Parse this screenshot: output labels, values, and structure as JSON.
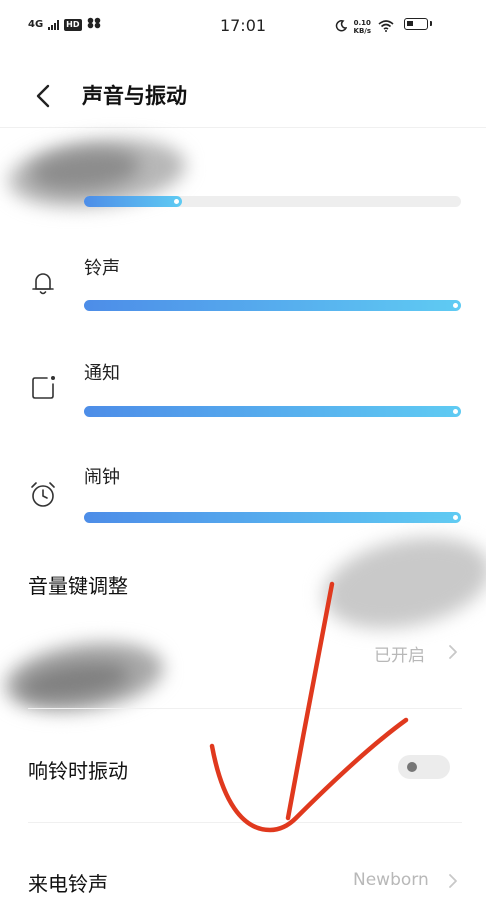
{
  "status_bar": {
    "network": "4G",
    "hd": "HD",
    "time": "17:01",
    "speed_value": "0.10",
    "speed_unit": "KB/s"
  },
  "header": {
    "title": "声音与振动"
  },
  "volume": {
    "media": {
      "level": 0.26
    },
    "ringtone": {
      "label": "铃声",
      "level": 1.0
    },
    "notification": {
      "label": "通知",
      "level": 1.0
    },
    "alarm": {
      "label": "闹钟",
      "level": 1.0
    }
  },
  "settings": {
    "volume_keys": {
      "label": "音量键调整"
    },
    "obscured_row": {
      "value": "已开启"
    },
    "vibrate_on_ring": {
      "label": "响铃时振动",
      "enabled": false
    },
    "ringtone_row": {
      "label": "来电铃声",
      "value": "Newborn"
    }
  },
  "colors": {
    "accent_start": "#4d8de8",
    "accent_end": "#5fcbf3",
    "annotation": "#e0391e"
  }
}
